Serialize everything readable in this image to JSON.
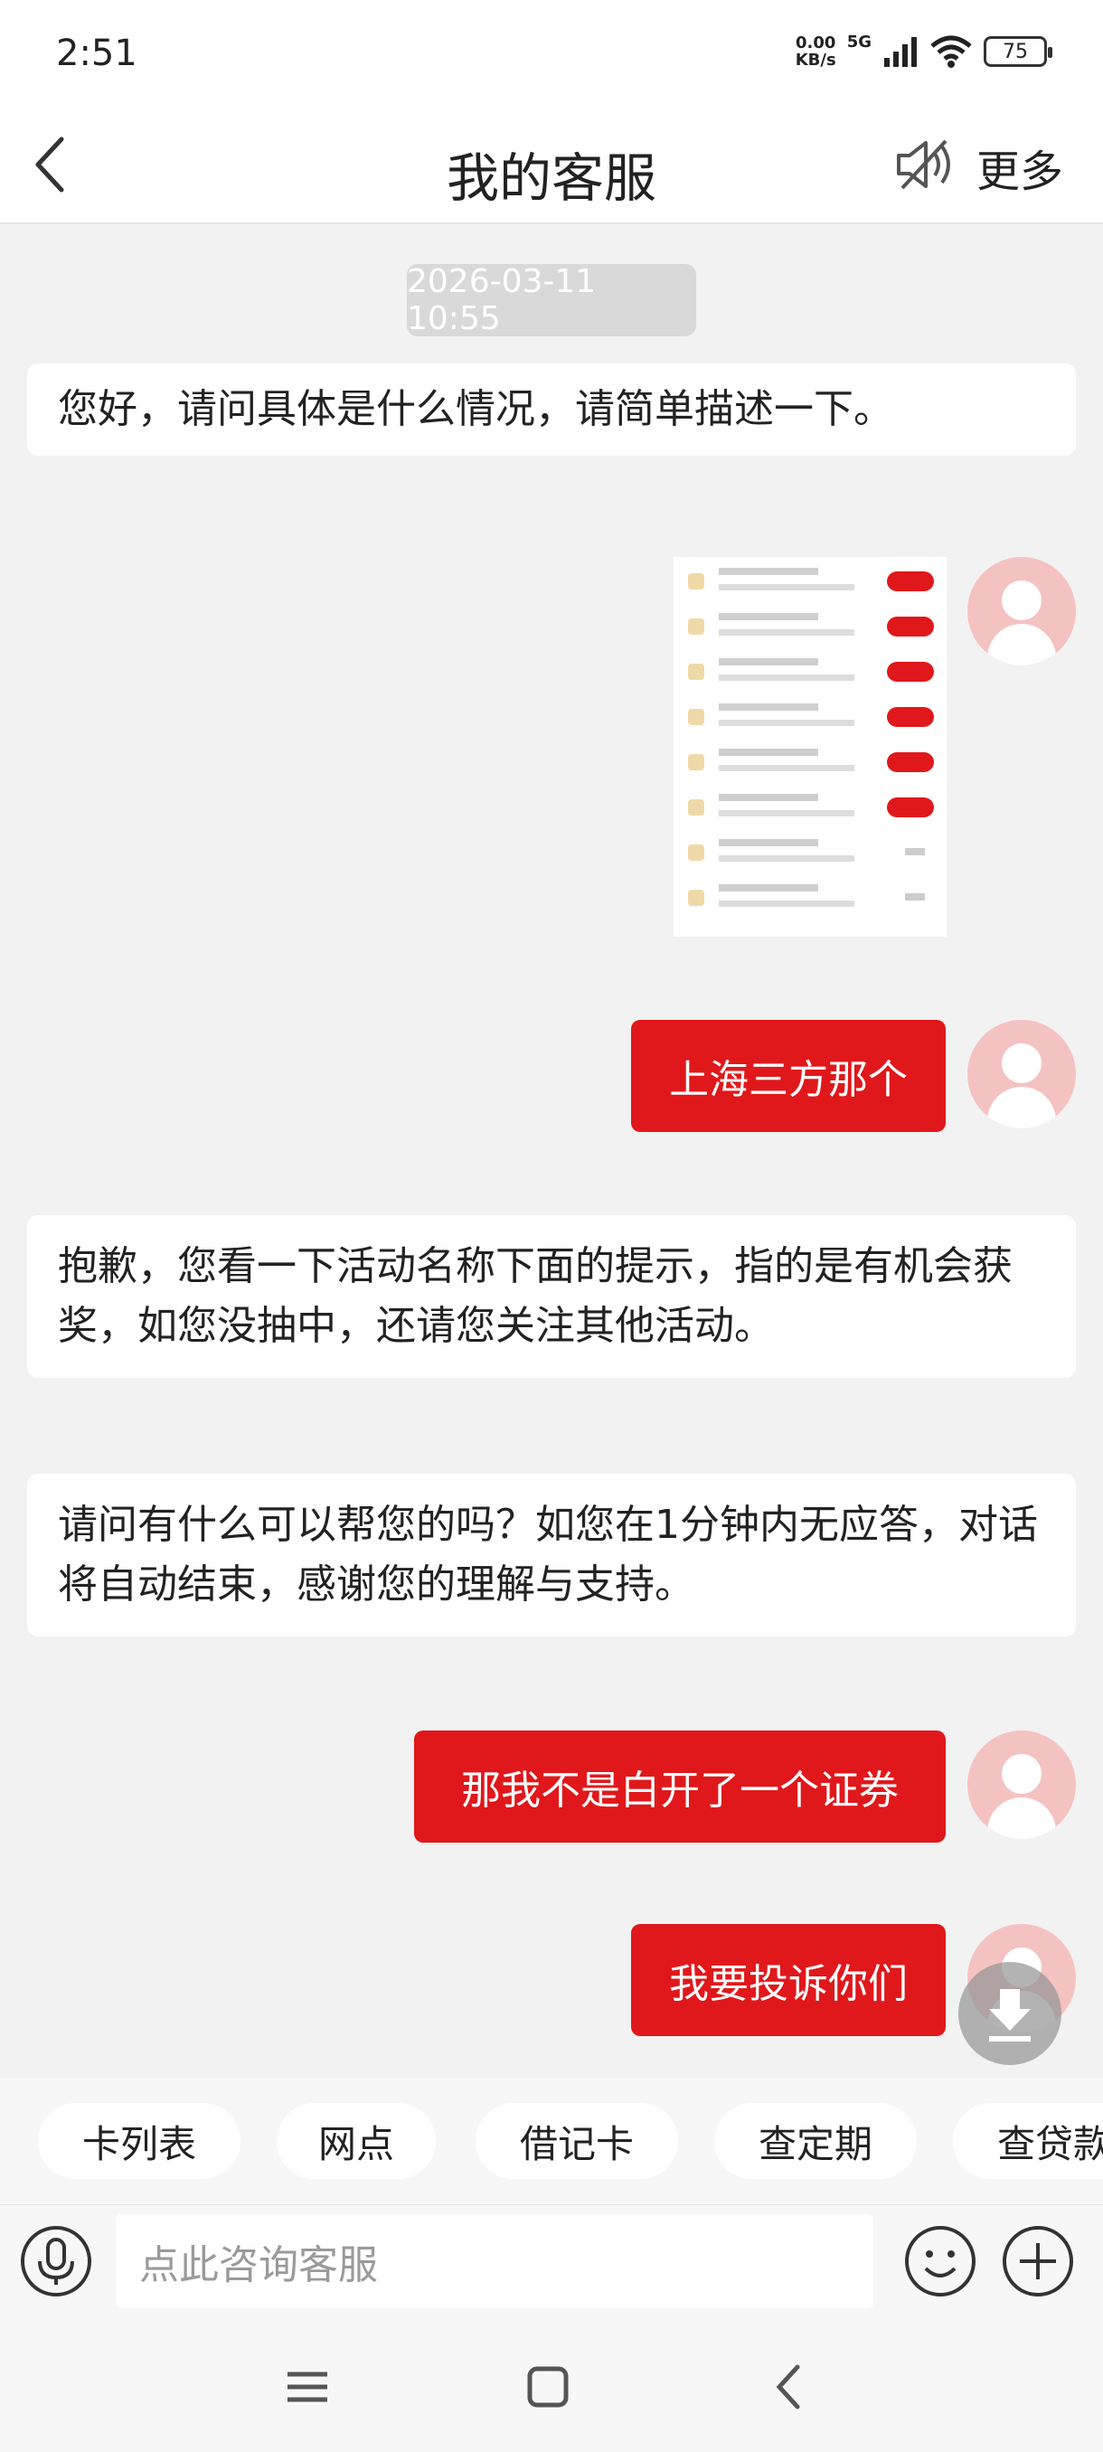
{
  "status_bar": {
    "time": "2:51",
    "net_speed_value": "0.00",
    "net_speed_unit": "KB/s",
    "network_type": "5G",
    "battery": "75"
  },
  "header": {
    "title": "我的客服",
    "more_label": "更多"
  },
  "chat": {
    "timestamp": "2026-03-11 10:55",
    "messages": [
      {
        "from": "agent",
        "text": "您好，请问具体是什么情况，请简单描述一下。"
      },
      {
        "from": "user",
        "type": "image",
        "text": ""
      },
      {
        "from": "user",
        "text": "上海三方那个"
      },
      {
        "from": "agent",
        "text": "抱歉，您看一下活动名称下面的提示，指的是有机会获奖，如您没抽中，还请您关注其他活动。"
      },
      {
        "from": "agent",
        "text": "请问有什么可以帮您的吗？如您在1分钟内无应答，对话将自动结束，感谢您的理解与支持。"
      },
      {
        "from": "user",
        "text": "那我不是白开了一个证券"
      },
      {
        "from": "user",
        "text": "我要投诉你们"
      }
    ]
  },
  "quick_replies": [
    "卡列表",
    "网点",
    "借记卡",
    "查定期",
    "查贷款"
  ],
  "input": {
    "placeholder": "点此咨询客服"
  },
  "colors": {
    "accent": "#e0181b",
    "avatar": "#f5c2c2",
    "background": "#f2f2f2"
  },
  "icons": {
    "back": "chevron-left-icon",
    "sound": "speaker-off-icon",
    "voice": "microphone-icon",
    "emoji": "smiley-icon",
    "plus": "plus-icon",
    "scroll": "download-arrow-icon"
  }
}
